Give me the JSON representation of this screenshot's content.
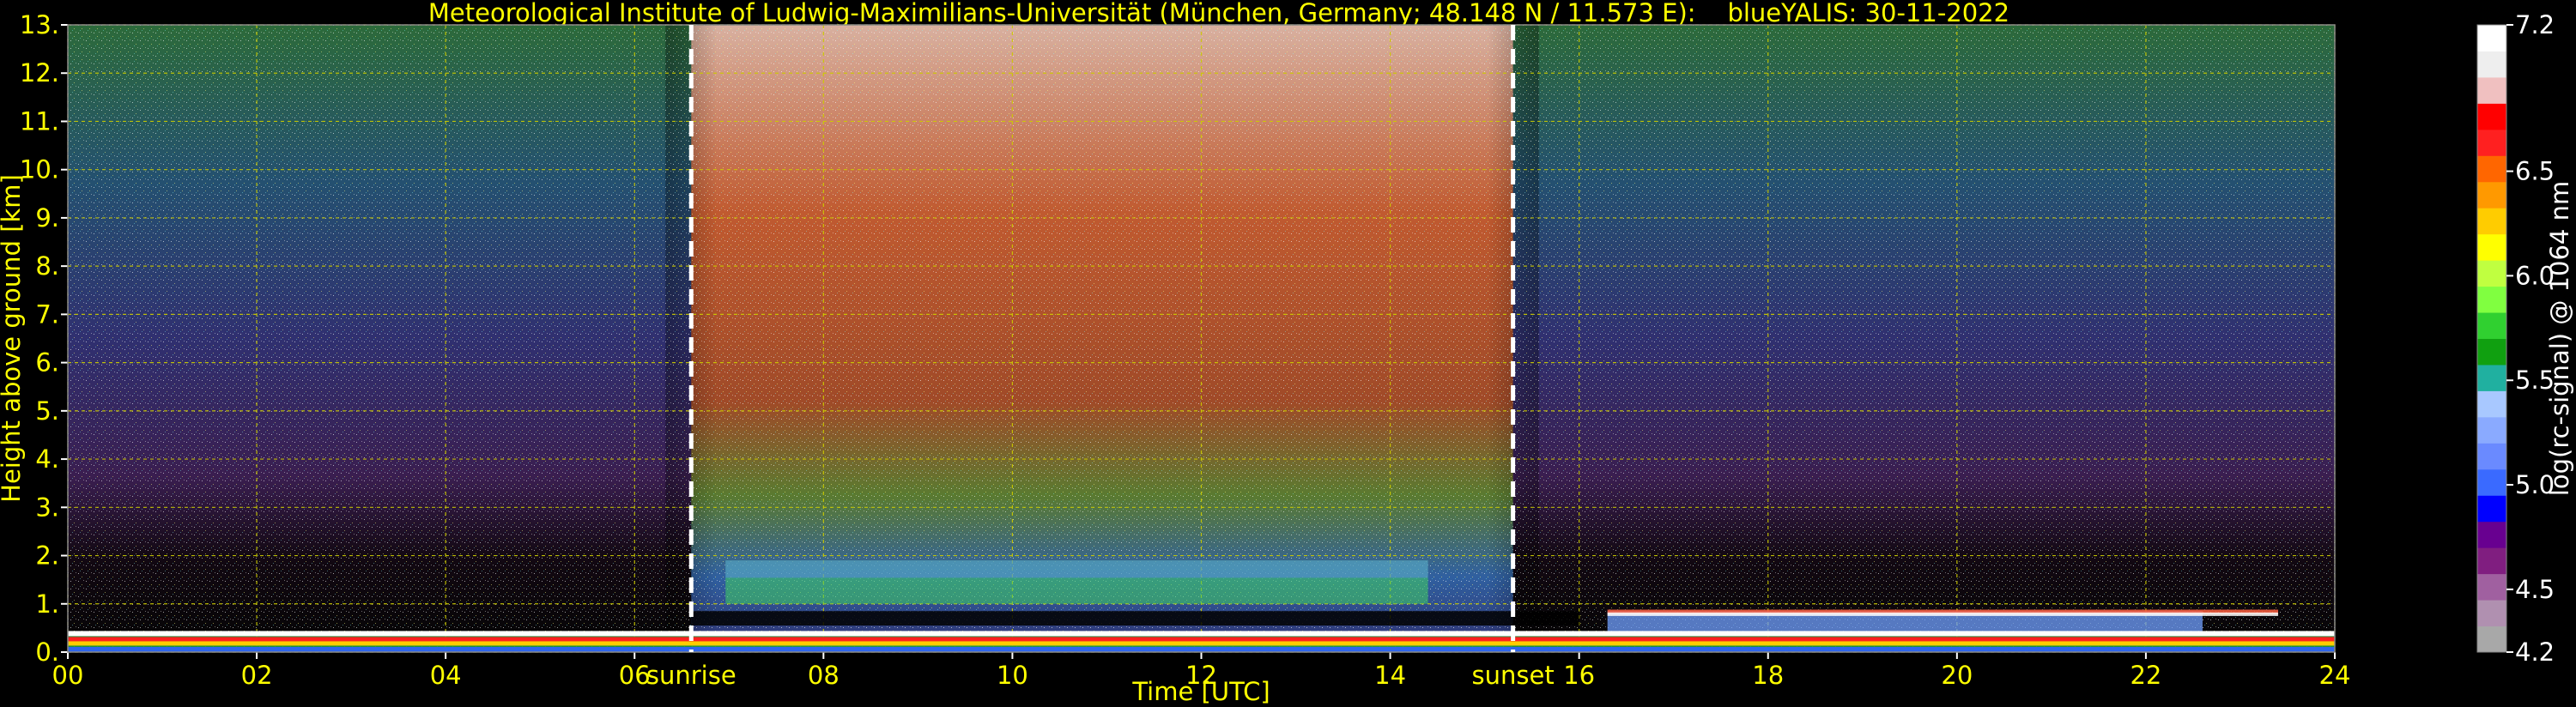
{
  "chart_data": {
    "type": "heatmap",
    "title": "Meteorological Institute of Ludwig-Maximilians-Universität (München, Germany; 48.148 N / 11.573 E):    blueYALIS: 30-11-2022",
    "xlabel": "Time [UTC]",
    "ylabel": "Height above ground [km]",
    "xlim": [
      0,
      24
    ],
    "ylim": [
      0,
      13
    ],
    "x_ticks": [
      "00",
      "02",
      "04",
      "06",
      "08",
      "10",
      "12",
      "14",
      "16",
      "18",
      "20",
      "22",
      "24"
    ],
    "y_ticks": [
      "0.",
      "1.",
      "2.",
      "3.",
      "4.",
      "5.",
      "6.",
      "7.",
      "8.",
      "9.",
      "10.",
      "11.",
      "12.",
      "13."
    ],
    "grid": true,
    "colorbar": {
      "label": "log(rc-signal) @ 1064 nm",
      "range": [
        4.2,
        7.2
      ],
      "ticks": [
        "4.2",
        "4.5",
        "5.0",
        "5.5",
        "6.0",
        "6.5",
        "7.2"
      ],
      "colors": [
        "#a8a8a8",
        "#b090b0",
        "#a060a0",
        "#801e80",
        "#680090",
        "#0000ff",
        "#3a6aff",
        "#6a8aff",
        "#8aaaff",
        "#a8c8ff",
        "#20b0a0",
        "#10a010",
        "#30d030",
        "#80ff40",
        "#c0ff40",
        "#ffff00",
        "#ffcc00",
        "#ff9900",
        "#ff6600",
        "#ff2020",
        "#ff0000",
        "#f0c0c0",
        "#eeeeee",
        "#ffffff"
      ]
    },
    "annotations": [
      {
        "text": "sunrise",
        "time": 6.6
      },
      {
        "text": "sunset",
        "time": 15.3
      }
    ],
    "layers": {
      "boundary_layer_top_km": 0.55,
      "residual_cloud_layer_km": [
        1.0,
        1.9
      ],
      "day_signal_range_utc": [
        6.6,
        15.3
      ]
    },
    "colors": {
      "text": "#ffff00",
      "grid": "#cccc00",
      "background": "#000000",
      "marker": "#ffffff"
    }
  }
}
